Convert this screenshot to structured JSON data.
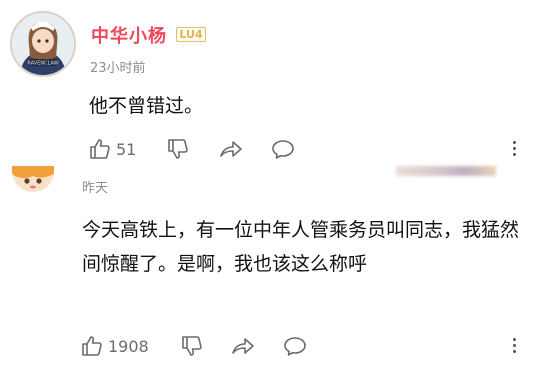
{
  "comments": [
    {
      "username": "中华小杨",
      "level_badge": "LU4",
      "time": "23小时前",
      "text": "他不曾错过。",
      "likes": "51",
      "avatar_label": "RAVENCLAW"
    },
    {
      "time": "昨天",
      "text": "今天高铁上，有一位中年人管乘务员叫同志，我猛然间惊醒了。是啊，我也该这么称呼",
      "likes": "1908"
    }
  ],
  "colors": {
    "username": "#f0465a",
    "badge": "#e0b64a",
    "icon": "#6b6b6b"
  },
  "icons": [
    "thumbs-up-icon",
    "thumbs-down-icon",
    "share-icon",
    "comment-icon",
    "more-icon"
  ]
}
